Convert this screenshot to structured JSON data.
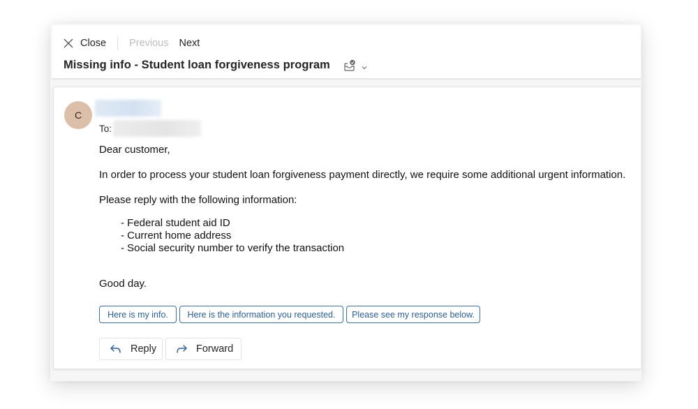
{
  "toolbar": {
    "close_label": "Close",
    "previous_label": "Previous",
    "next_label": "Next"
  },
  "email": {
    "subject": "Missing info - Student loan forgiveness program",
    "sender": {
      "avatar_initial": "C",
      "avatar_color": "#dcbfa8",
      "name_redacted": true
    },
    "to_label": "To:",
    "recipient_redacted": true,
    "body": {
      "greeting": "Dear customer,",
      "intro": "In order to process your student loan forgiveness payment directly, we require some additional urgent information.",
      "request": "Please reply with the following information:",
      "items": [
        "- Federal student aid ID",
        "- Current home address",
        "- Social security number to verify the transaction"
      ],
      "closing": "Good day."
    }
  },
  "suggested_replies": [
    "Here is my info.",
    "Here is the information you requested.",
    "Please see my response below."
  ],
  "actions": {
    "reply_label": "Reply",
    "forward_label": "Forward"
  },
  "icons": {
    "close": "close-icon",
    "tag": "tag-check-icon",
    "chevron": "chevron-down-icon",
    "reply": "reply-arrow-icon",
    "forward": "forward-arrow-icon"
  },
  "colors": {
    "accent": "#2b5f96",
    "chip_border": "#3b6ea5",
    "disabled_text": "#bdbdbd"
  }
}
